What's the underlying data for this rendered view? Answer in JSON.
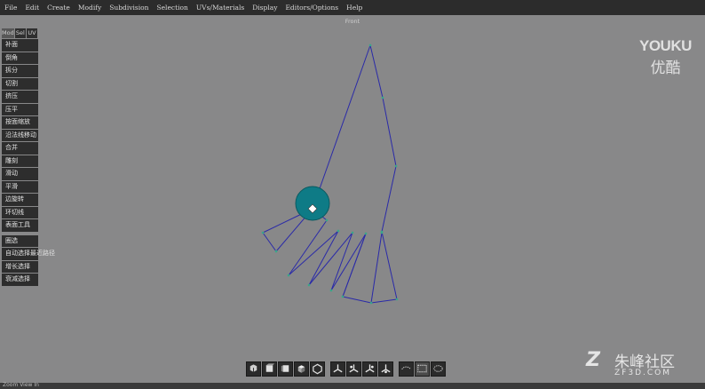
{
  "menu": [
    "File",
    "Edit",
    "Create",
    "Modify",
    "Subdivision",
    "Selection",
    "UVs/Materials",
    "Display",
    "Editors/Options",
    "Help"
  ],
  "viewport": {
    "label": "Front"
  },
  "side_panel": {
    "tabs": [
      {
        "label": "Mod",
        "active": true
      },
      {
        "label": "Sel",
        "active": false
      },
      {
        "label": "UV",
        "active": false
      }
    ],
    "tools": [
      "补面",
      "倒角",
      "拆分",
      "切割",
      "挤压",
      "压平",
      "按面缩放",
      "沿法线移动",
      "合并",
      "雕刻",
      "滑动",
      "平滑",
      "边旋转",
      "环切线",
      "表面工具"
    ],
    "selection_tools": [
      "圈选",
      "自动选择最近路径",
      "增长选择",
      "衰减选择"
    ]
  },
  "watermarks": {
    "youku_latin": "YOUKU",
    "youku_cjk": "优酷",
    "zf_cjk": "朱峰社区",
    "zf_url": "ZF3D.COM"
  },
  "bottom_toolbar": {
    "buttons": [
      "view-cube-icon",
      "front-view-icon",
      "side-view-icon",
      "top-view-icon",
      "perspective-view-icon",
      "axis-x-icon",
      "axis-y-icon",
      "axis-z-icon",
      "axis-all-icon",
      "lasso-select-icon",
      "rect-select-icon",
      "paint-select-icon"
    ],
    "selected": "rect-select-icon"
  },
  "status_bar": {
    "text": "Zoom View In"
  },
  "colors": {
    "edge": "#2a2aa8",
    "vertex": "#3aa58a",
    "brush": "#0e7b86",
    "background": "#888889"
  }
}
